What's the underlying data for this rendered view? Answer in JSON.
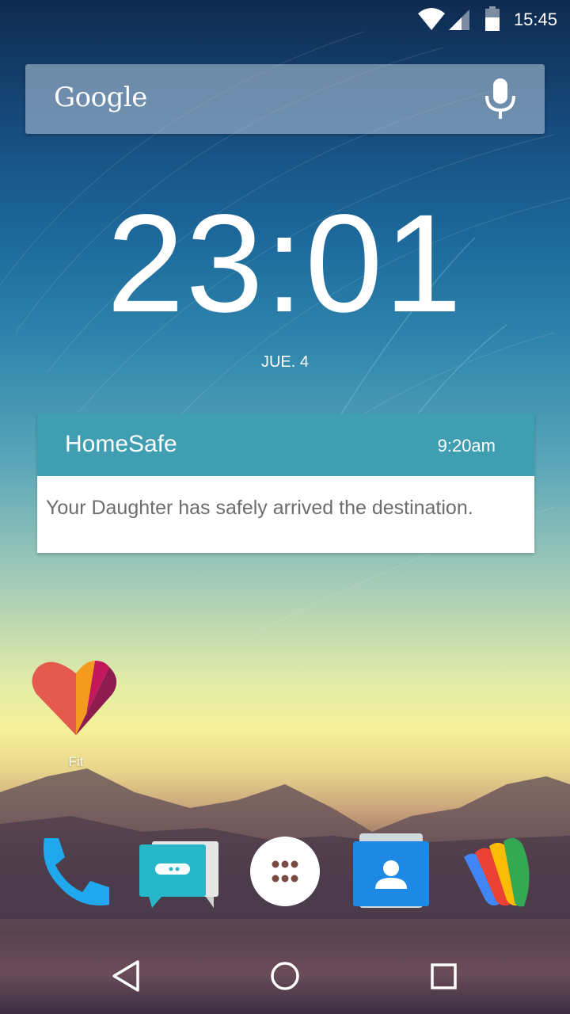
{
  "status_bar": {
    "time": "15:45",
    "icons": [
      "wifi-icon",
      "cell-signal-icon",
      "battery-icon"
    ]
  },
  "search": {
    "logo_text": "Google",
    "mic_icon": "mic-icon"
  },
  "clock_widget": {
    "time": "23:01",
    "date": "JUE. 4"
  },
  "notification": {
    "app_name": "HomeSafe",
    "time": "9:20am",
    "message": "Your Daughter has safely arrived the destination.",
    "header_color": "#3f9eb1"
  },
  "home_apps": [
    {
      "label": "Fit",
      "icon": "google-fit-heart-icon"
    }
  ],
  "dock": [
    {
      "icon": "phone-icon"
    },
    {
      "icon": "messenger-icon"
    },
    {
      "icon": "app-drawer-icon"
    },
    {
      "icon": "contacts-icon"
    },
    {
      "icon": "google-wallet-icon"
    }
  ],
  "nav_bar": [
    "back-icon",
    "home-icon",
    "recents-icon"
  ]
}
